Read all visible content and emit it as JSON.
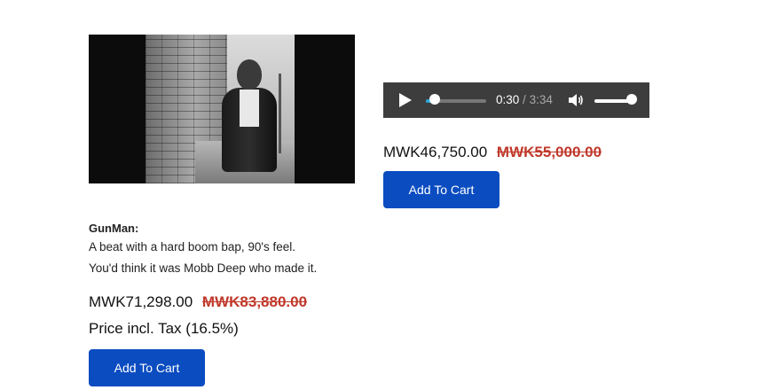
{
  "products": [
    {
      "title": "GunMan:",
      "description_lines": [
        "A beat with a hard boom bap, 90's feel.",
        "You'd think it was Mobb Deep who made it."
      ],
      "price_current": "MWK71,298.00",
      "price_original": "MWK83,880.00",
      "tax_note": "Price incl. Tax (16.5%)",
      "button_label": "Add To Cart",
      "thumbnail_icon": "video-thumbnail-image"
    },
    {
      "audio": {
        "current_time": "0:30",
        "separator": "/",
        "duration": "3:34",
        "progress_fraction": 0.14,
        "volume_fraction": 0.95
      },
      "price_current": "MWK46,750.00",
      "price_original": "MWK55,000.00",
      "button_label": "Add To Cart"
    }
  ],
  "colors": {
    "accent_button": "#0b4cc1",
    "old_price": "#c0392b",
    "audio_bar": "#3d3d3d",
    "audio_progress": "#29a3d8"
  }
}
